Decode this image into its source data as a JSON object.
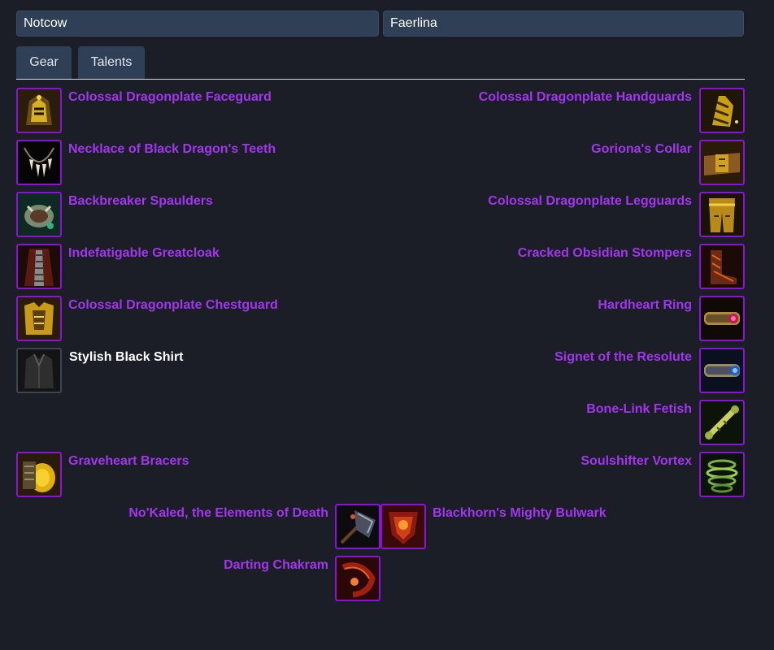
{
  "inputs": {
    "character_1": "Notcow",
    "character_2": "Faerlina"
  },
  "tabs": [
    {
      "label": "Gear"
    },
    {
      "label": "Talents"
    }
  ],
  "colors": {
    "epic": "#a335ee",
    "common": "#ffffff",
    "field_bg": "#2e3f56",
    "page_bg": "#1b1e27"
  },
  "gear": {
    "left": [
      {
        "name": "Colossal Dragonplate Faceguard",
        "quality": "epic",
        "icon": "helmet-icon"
      },
      {
        "name": "Necklace of Black Dragon's Teeth",
        "quality": "epic",
        "icon": "necklace-icon"
      },
      {
        "name": "Backbreaker Spaulders",
        "quality": "epic",
        "icon": "shoulders-icon"
      },
      {
        "name": "Indefatigable Greatcloak",
        "quality": "epic",
        "icon": "cloak-icon"
      },
      {
        "name": "Colossal Dragonplate Chestguard",
        "quality": "epic",
        "icon": "chest-icon"
      },
      {
        "name": "Stylish Black Shirt",
        "quality": "common",
        "icon": "shirt-icon"
      },
      {
        "name": "Graveheart Bracers",
        "quality": "epic",
        "icon": "bracers-icon"
      }
    ],
    "right": [
      {
        "name": "Colossal Dragonplate Handguards",
        "quality": "epic",
        "icon": "gloves-icon"
      },
      {
        "name": "Goriona's Collar",
        "quality": "epic",
        "icon": "belt-icon"
      },
      {
        "name": "Colossal Dragonplate Legguards",
        "quality": "epic",
        "icon": "legs-icon"
      },
      {
        "name": "Cracked Obsidian Stompers",
        "quality": "epic",
        "icon": "boots-icon"
      },
      {
        "name": "Hardheart Ring",
        "quality": "epic",
        "icon": "ring-icon"
      },
      {
        "name": "Signet of the Resolute",
        "quality": "epic",
        "icon": "ring-icon"
      },
      {
        "name": "Bone-Link Fetish",
        "quality": "epic",
        "icon": "bone-trinket-icon"
      },
      {
        "name": "Soulshifter Vortex",
        "quality": "epic",
        "icon": "vortex-trinket-icon"
      }
    ],
    "weapons": {
      "main_hand": {
        "name": "No'Kaled, the Elements of Death",
        "quality": "epic",
        "icon": "axe-icon"
      },
      "off_hand": {
        "name": "Blackhorn's Mighty Bulwark",
        "quality": "epic",
        "icon": "shield-icon"
      },
      "ranged": {
        "name": "Darting Chakram",
        "quality": "epic",
        "icon": "chakram-icon"
      }
    }
  }
}
